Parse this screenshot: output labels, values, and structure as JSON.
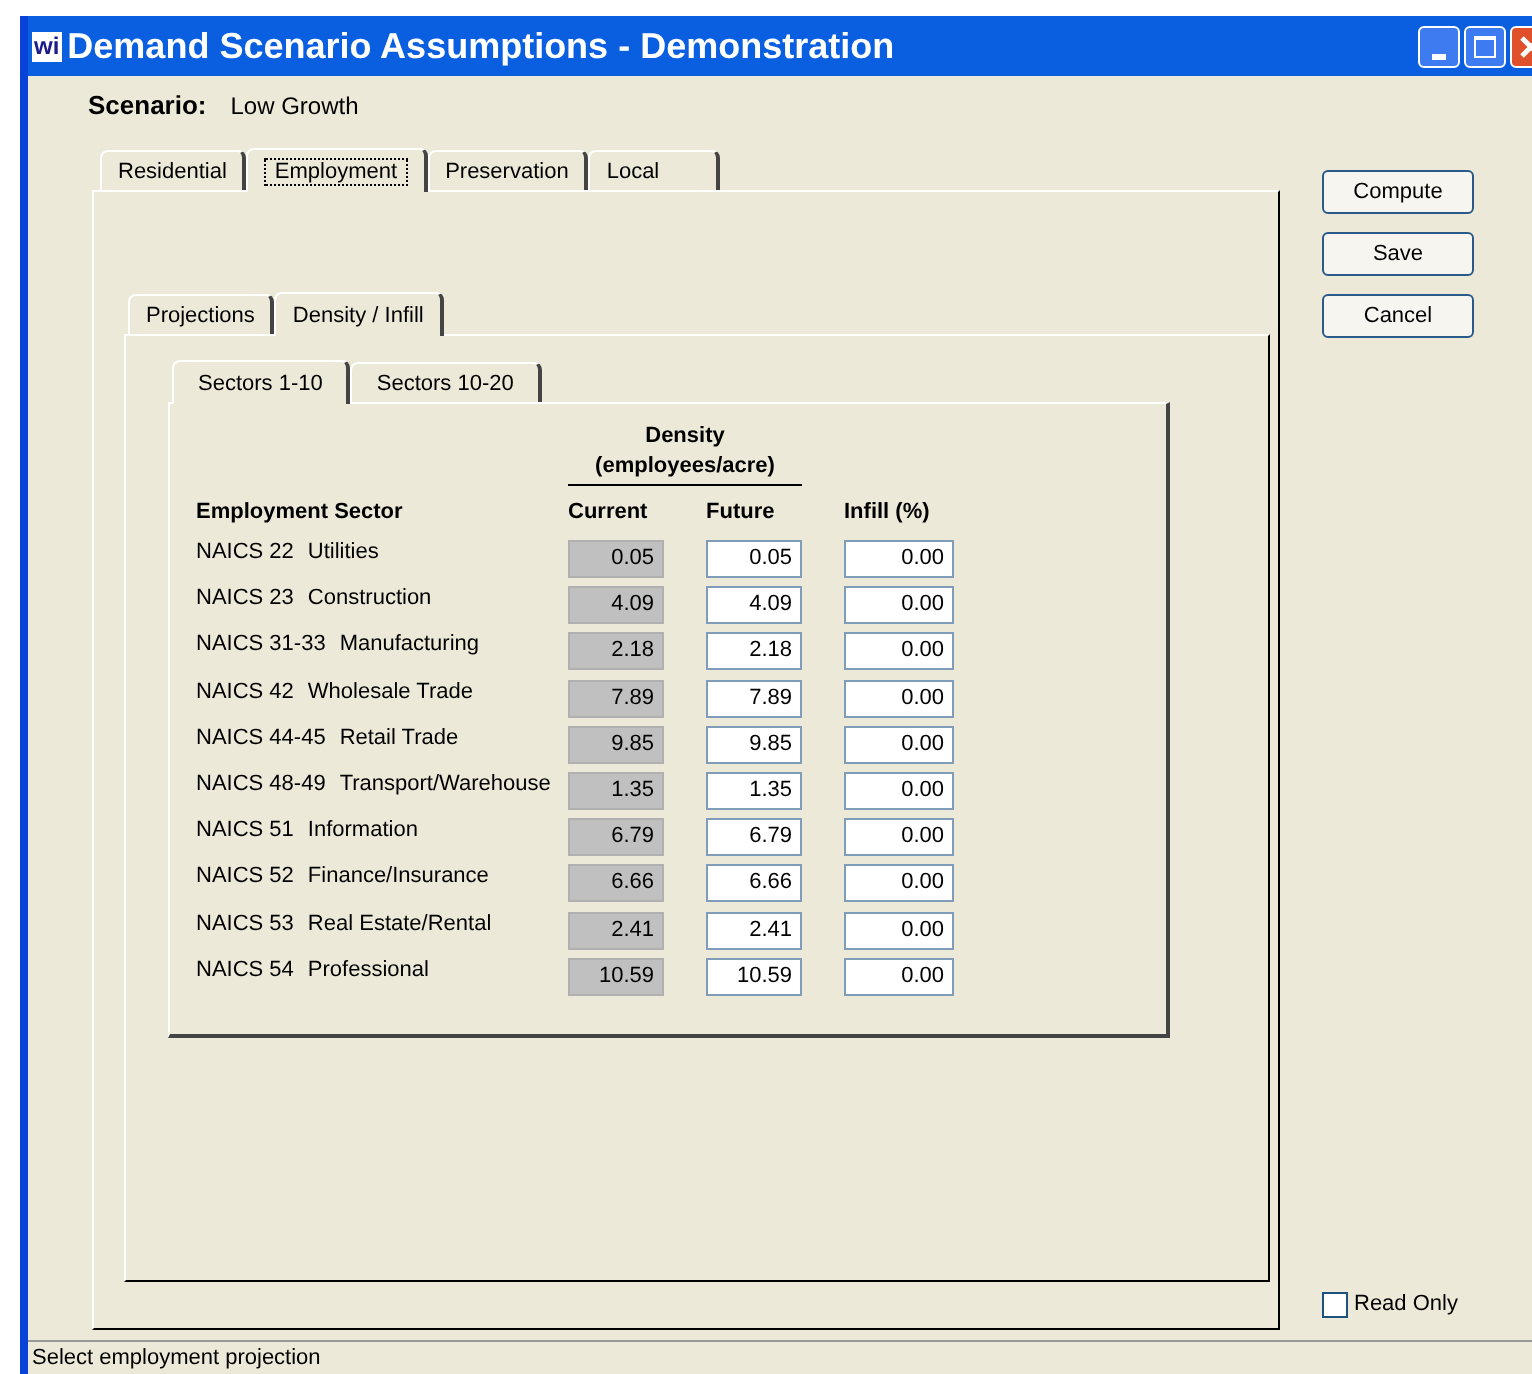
{
  "window": {
    "title": "Demand Scenario Assumptions - Demonstration",
    "app_icon": "wi"
  },
  "scenario": {
    "label": "Scenario:",
    "value": "Low Growth"
  },
  "tabs": [
    {
      "label": "Residential",
      "selected": false
    },
    {
      "label": "Employment",
      "selected": true
    },
    {
      "label": "Preservation",
      "selected": false
    },
    {
      "label": "Local",
      "selected": false
    }
  ],
  "subtabs": [
    {
      "label": "Projections",
      "selected": false
    },
    {
      "label": "Density / Infill",
      "selected": true
    }
  ],
  "sector_tabs": [
    {
      "label": "Sectors 1-10",
      "selected": true
    },
    {
      "label": "Sectors 10-20",
      "selected": false
    }
  ],
  "table": {
    "group_heading": "Density",
    "group_subheading": "(employees/acre)",
    "columns": [
      "Employment Sector",
      "Current",
      "Future",
      "Infill (%)"
    ],
    "rows": [
      {
        "code": "NAICS 22",
        "name": "Utilities",
        "current": "0.05",
        "future": "0.05",
        "infill": "0.00"
      },
      {
        "code": "NAICS 23",
        "name": "Construction",
        "current": "4.09",
        "future": "4.09",
        "infill": "0.00"
      },
      {
        "code": "NAICS 31-33",
        "name": "Manufacturing",
        "current": "2.18",
        "future": "2.18",
        "infill": "0.00"
      },
      {
        "code": "NAICS 42",
        "name": "Wholesale Trade",
        "current": "7.89",
        "future": "7.89",
        "infill": "0.00"
      },
      {
        "code": "NAICS 44-45",
        "name": "Retail Trade",
        "current": "9.85",
        "future": "9.85",
        "infill": "0.00"
      },
      {
        "code": "NAICS 48-49",
        "name": "Transport/Warehouse",
        "current": "1.35",
        "future": "1.35",
        "infill": "0.00"
      },
      {
        "code": "NAICS 51",
        "name": "Information",
        "current": "6.79",
        "future": "6.79",
        "infill": "0.00"
      },
      {
        "code": "NAICS 52",
        "name": "Finance/Insurance",
        "current": "6.66",
        "future": "6.66",
        "infill": "0.00"
      },
      {
        "code": "NAICS 53",
        "name": "Real Estate/Rental",
        "current": "2.41",
        "future": "2.41",
        "infill": "0.00"
      },
      {
        "code": "NAICS 54",
        "name": "Professional",
        "current": "10.59",
        "future": "10.59",
        "infill": "0.00"
      }
    ]
  },
  "buttons": [
    "Compute",
    "Save",
    "Cancel"
  ],
  "read_only": {
    "label": "Read Only",
    "checked": false
  },
  "status_bar": "Select employment projection"
}
